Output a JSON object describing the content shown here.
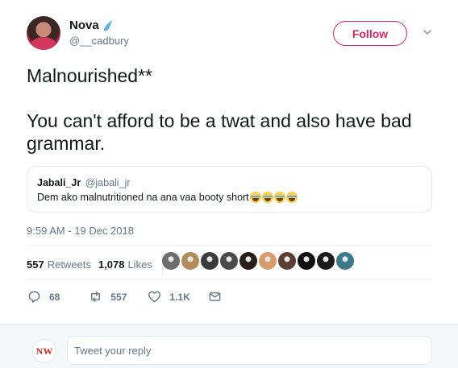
{
  "user": {
    "name": "Nova",
    "handle": "@__cadbury",
    "badge_icon": "water-drop-icon"
  },
  "follow_label": "Follow",
  "tweet": {
    "line1": "Malnourished**",
    "line2": "You can't afford to be a twat and also have bad grammar."
  },
  "quoted": {
    "name": "Jabali_Jr",
    "handle": "@jabali_jr",
    "body": "Dem ako malnutritioned na ana vaa booty short",
    "emoji_icon": "face-with-tears-of-joy-icon",
    "emoji_count": 4
  },
  "timestamp": "9:59 AM - 19 Dec 2018",
  "stats": {
    "retweets": "557",
    "retweets_label": "Retweets",
    "likes": "1,078",
    "likes_label": "Likes"
  },
  "likers": [
    {
      "color": "#6d6d6d"
    },
    {
      "color": "#b38c5a"
    },
    {
      "color": "#3b3b3b"
    },
    {
      "color": "#4a4a4a"
    },
    {
      "color": "#2a1e1a"
    },
    {
      "color": "#d99a6c"
    },
    {
      "color": "#5a4030"
    },
    {
      "color": "#111111"
    },
    {
      "color": "#1b1b1b"
    },
    {
      "color": "#3a7a8a"
    }
  ],
  "actions": {
    "replies": "68",
    "retweets": "557",
    "likes": "1.1K"
  },
  "reply": {
    "avatar_text": "NW",
    "placeholder": "Tweet your reply"
  },
  "colors": {
    "accent": "#e0245e",
    "muted": "#657786",
    "border": "#e6ecf0"
  }
}
